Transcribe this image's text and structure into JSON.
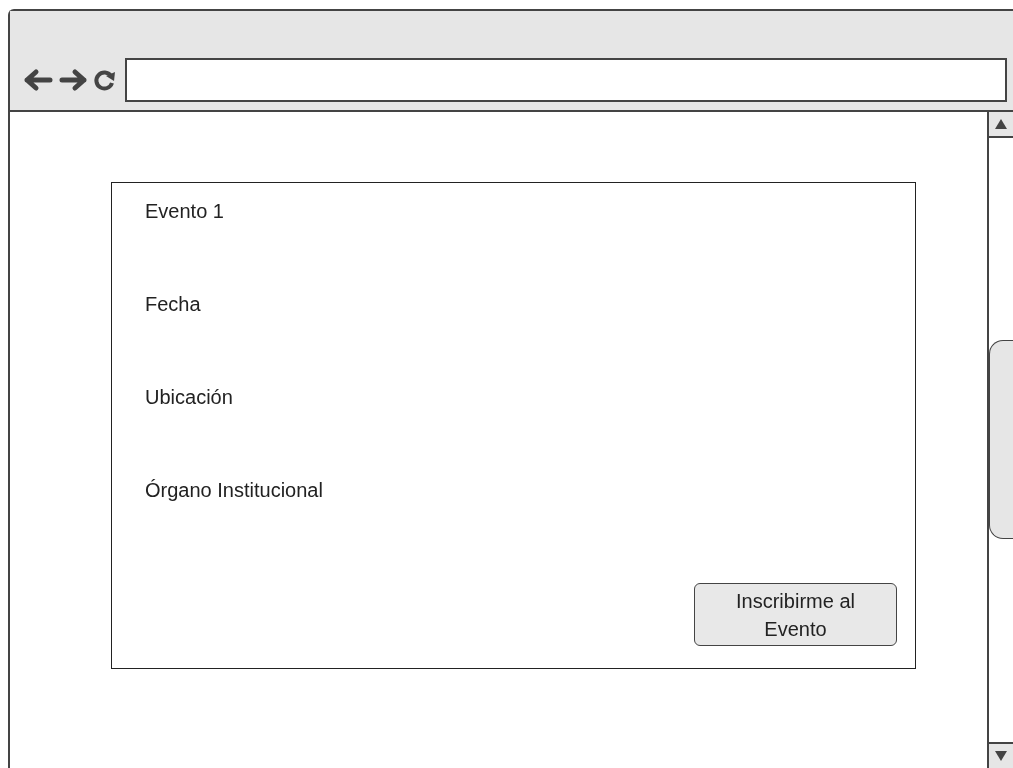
{
  "event_card": {
    "fields": [
      {
        "text": "Evento 1"
      },
      {
        "text": "Fecha"
      },
      {
        "text": "Ubicación"
      },
      {
        "text": "Órgano Institucional"
      }
    ],
    "button": "Inscribirme al Evento"
  }
}
